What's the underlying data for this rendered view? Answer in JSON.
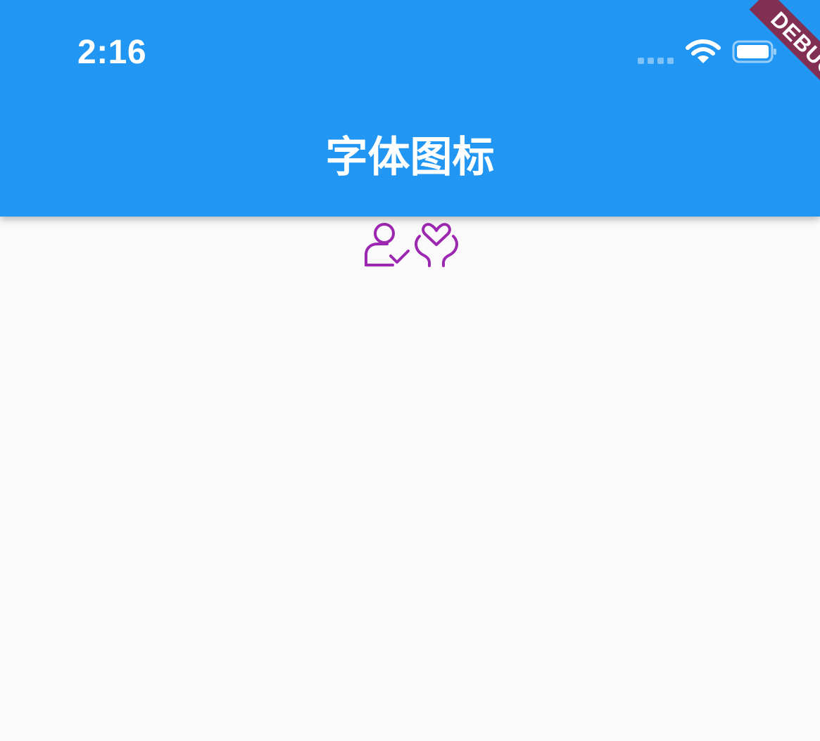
{
  "status_bar": {
    "time": "2:16",
    "signal_icon": "cellular-signal-icon",
    "wifi_icon": "wifi-icon",
    "battery_icon": "battery-icon"
  },
  "app_bar": {
    "title": "字体图标",
    "background_color": "#2196f3"
  },
  "debug_banner": {
    "label": "DEBUG",
    "color": "#8c2440"
  },
  "content": {
    "background_color": "#fafafa",
    "icon_color": "#9c27b0",
    "icons": [
      "user-check-icon",
      "hands-heart-icon"
    ]
  }
}
